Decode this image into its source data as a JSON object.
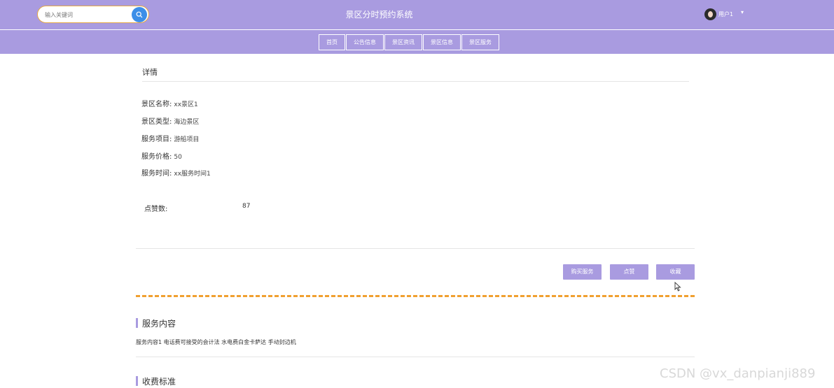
{
  "header": {
    "search_placeholder": "输入关键词",
    "app_title": "景区分时预约系统",
    "user_name": "用户1",
    "user_caret": "▾"
  },
  "nav": {
    "items": [
      {
        "label": "首页"
      },
      {
        "label": "公告信息"
      },
      {
        "label": "景区资讯"
      },
      {
        "label": "景区信息"
      },
      {
        "label": "景区服务"
      }
    ]
  },
  "detail": {
    "title": "详情",
    "fields": [
      {
        "label": "景区名称:",
        "value": "xx景区1"
      },
      {
        "label": "景区类型:",
        "value": "海边景区"
      },
      {
        "label": "服务项目:",
        "value": "游船项目"
      },
      {
        "label": "服务价格:",
        "value": "50"
      },
      {
        "label": "服务时间:",
        "value": "xx服务时间1"
      }
    ],
    "likes_label": "点赞数:",
    "likes_value": "87"
  },
  "actions": {
    "buy_label": "购买服务",
    "like_label": "点赞",
    "favorite_label": "收藏"
  },
  "sections": {
    "service_content_title": "服务内容",
    "service_content_text": "服务内容1 电话费可接受的会计法 水电费白金卡萨达 手动封边机",
    "fee_standard_title": "收费标准"
  },
  "watermark": "CSDN @vx_danpianji889",
  "colors": {
    "accent": "#a99be0",
    "search_button": "#3d8fe8",
    "divider_dashed": "#f0a030"
  }
}
